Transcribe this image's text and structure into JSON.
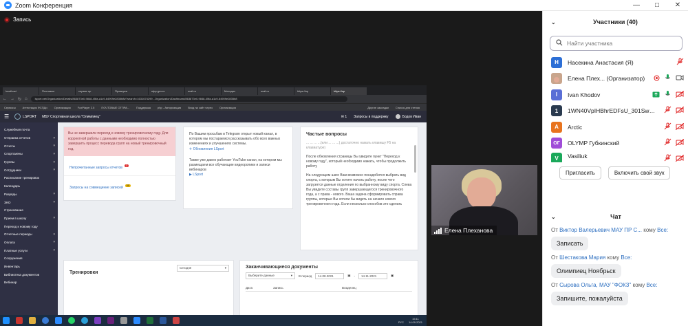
{
  "window": {
    "title": "Zoom Конференция"
  },
  "recording": {
    "label": "Запись"
  },
  "browser": {
    "tabs": [
      "localhost",
      "Почтовые",
      "сервис пр",
      "Проверка",
      "пфр.gov.ru",
      "mail.ru",
      "Методич",
      "mail.ru",
      "https://sp",
      "https://sp"
    ],
    "url": "lsport.net/Organization/Details/863873e0-9848-45fa-a1c9-64909e2835b8#?search=1631674299...Organization/Dashboard/863873e0-9848-45fa-a1c9-64909e2835b8",
    "bookmarks": [
      "Сервисы",
      "Аттестация ФСПДи",
      "Организация",
      "FoxPlayer 2.5",
      "ПОЧТОВЫЕ ОТПРА...",
      "Поддержка",
      "php - Авторизация",
      "Вход на сайт через",
      "Организация",
      "Другие закладки",
      "Список для чтения"
    ]
  },
  "site": {
    "logo": "LSPORT",
    "org": "МБУ Спортивная школа \"Олимпиец\"",
    "notif_count": "1",
    "support": "Запросы в поддержку",
    "user": "Бодов Иван",
    "menu": [
      "Служебная почта",
      "Отправка отчетов",
      "Отчеты",
      "Спортсмены",
      "Группы",
      "Сотрудники",
      "Расписание тренировок",
      "Календарь",
      "Разряды",
      "ЭКО",
      "Страхование",
      "Прием в школу",
      "Переход к новому году",
      "Отчетные периоды",
      "Оплата",
      "Платные услуги",
      "Сооружения",
      "Инвентарь",
      "Библиотека документов",
      "Вебинар"
    ],
    "warning": "Вы не завершили переход к новому тренировочному году. Для корректной работы с данными необходимо полностью завершить процесс перевода групп на новый тренировочный год.",
    "link1": "Непрочитанные запросы отчетов",
    "badge1": "1",
    "link2": "Запросы на совмещение записей",
    "badge2": "58",
    "telegram_text": "По Вашим просьбам в Telegram открыт новый канал, в котором мы постараемся рассказывать обо всех важных изменениях и улучшениях системы.",
    "telegram_link": "Обновления LSport",
    "youtube_text": "Также уже давно работает YouTube канал, на котором мы размещаем все обучающие видеоролики и записи вебинаров",
    "youtube_link": "LSport",
    "faq_title": "Частые вопросы",
    "faq_p0": "... ... ... ...(или ... ... ...) достаточно нажать клавишу F5 на клавиатуре)",
    "faq_p1": "После обновления страницы Вы увидите пункт \"Переход к новому году\", который необходимо нажать, чтобы продолжить работу",
    "faq_p2": "На следующем шаге Вам возможно понадобится выбрать вид спорта, с которым Вы хотите начать работу, после чего загрузятся данные отделения по выбранному виду спорта. Слева Вы увидите составы групп завершающегося тренировочного года, а с права - нового. Ваша задача сформировать справа группы, которые Вы хотели бы видеть на начало нового тренировочного года. Если несколько способов это сделать",
    "trainings_title": "Тренировки",
    "trainings_select": "Сегодня",
    "docs_title": "Заканчивающиеся документы",
    "docs_select": "Выберите данные",
    "docs_period": "В период",
    "date_from": "14.08.2021",
    "date_to": "14.11.2021",
    "cols": [
      "Дата",
      "Запись",
      "Владелец"
    ]
  },
  "taskbar": {
    "lang": "РУС",
    "time": "15:11",
    "date": "14.09.2021"
  },
  "video": {
    "name": "Елена Плеханова"
  },
  "participants": {
    "title": "Участники (40)",
    "search_placeholder": "Найти участника",
    "list": [
      {
        "initial": "Н",
        "name": "Насекина Анастасия (Я)",
        "color": "#2d6fd6"
      },
      {
        "initial": "",
        "name": "Елена Плех... (Организатор)",
        "color": "#c9a58c"
      },
      {
        "initial": "I",
        "name": "Ivan Khodov",
        "color": "#5a6ed6"
      },
      {
        "initial": "1",
        "name": "1WN40VpIHBhrEDFsU_301SwKg...",
        "color": "#2a3a4f"
      },
      {
        "initial": "A",
        "name": "Arctic",
        "color": "#e8741e"
      },
      {
        "initial": "ОГ",
        "name": "OLYMP Губкинский",
        "color": "#a04cd8"
      },
      {
        "initial": "V",
        "name": "Vasiliuk",
        "color": "#1aa85a"
      }
    ],
    "invite": "Пригласить",
    "unmute": "Включить свой звук"
  },
  "chat": {
    "title": "Чат",
    "messages": [
      {
        "from": "От",
        "who": "Виктор Валерьевич МАУ ПР С...",
        "to": "кому",
        "all": "Все:",
        "text": "Записать"
      },
      {
        "from": "От",
        "who": "Шестакова Мария",
        "to": "кому",
        "all": "Все:",
        "text": "Олимпиец Ноябрьск"
      },
      {
        "from": "От",
        "who": "Сырова Ольга, МАУ \"ФОКЗ\"",
        "to": "кому",
        "all": "Все:",
        "text": "Запишите, пожалуйста"
      }
    ]
  },
  "colors": {
    "zoom_blue": "#2d8cff",
    "muted_red": "#e02828",
    "site_sidebar": "#2f3044"
  }
}
